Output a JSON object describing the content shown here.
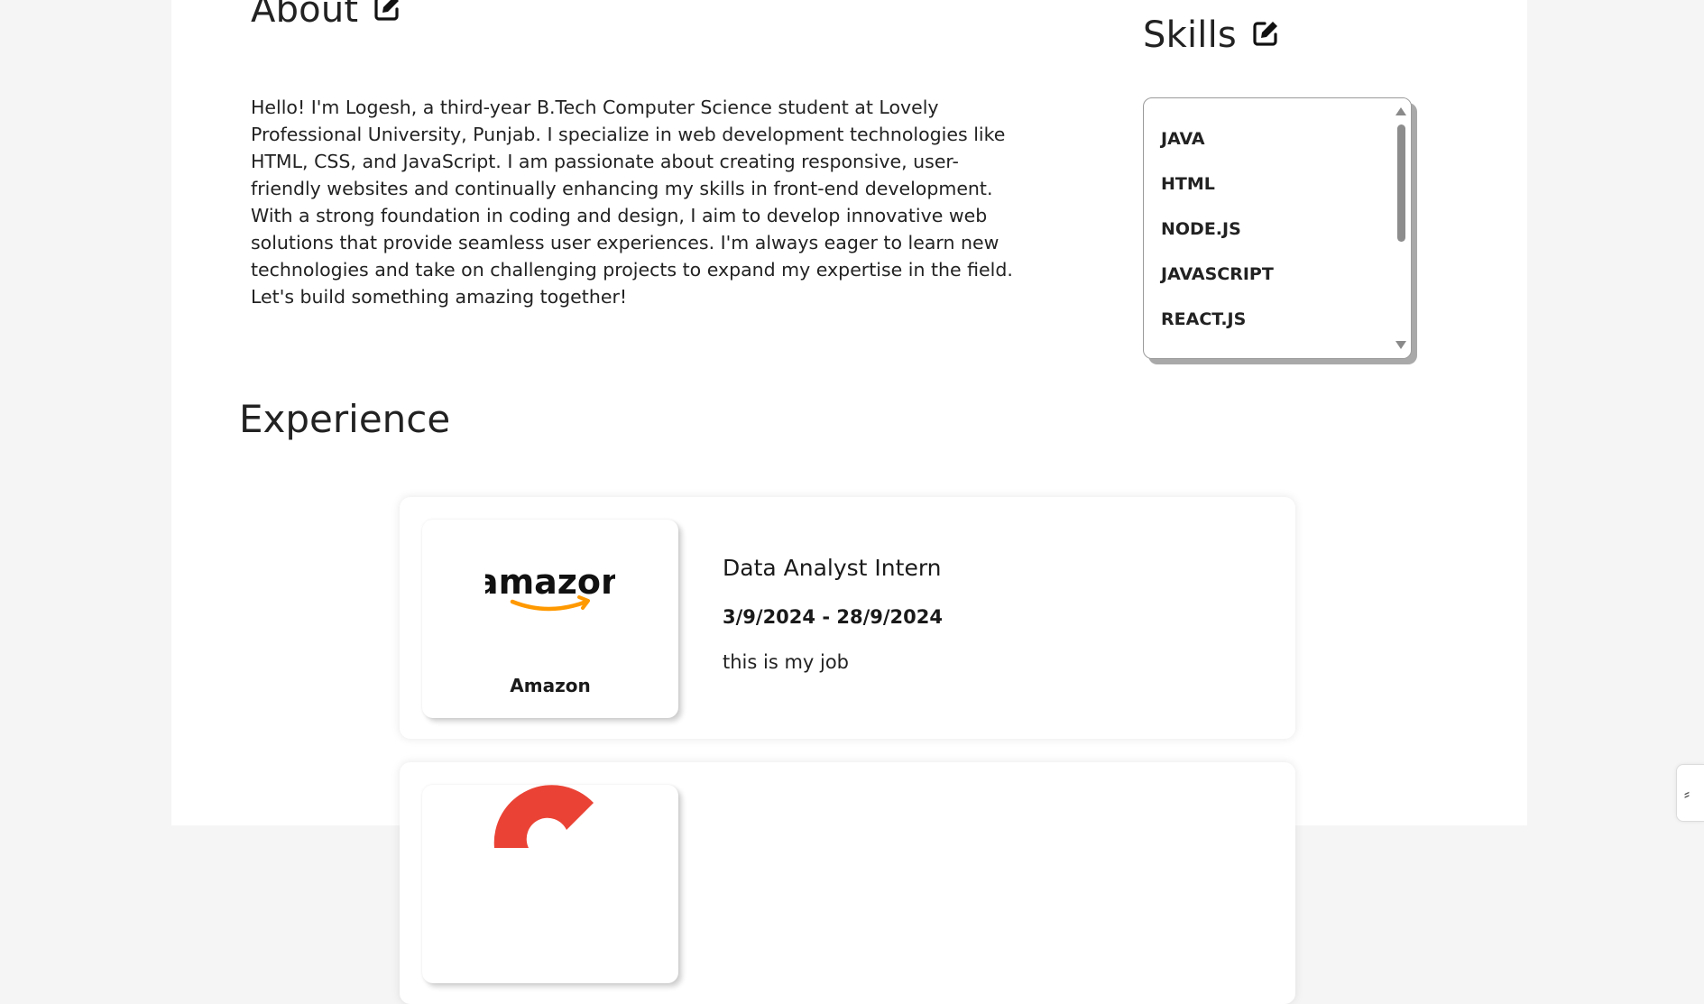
{
  "about": {
    "title": "About",
    "text": "Hello! I'm Logesh, a third-year B.Tech Computer Science student at Lovely Professional University, Punjab. I specialize in web development technologies like HTML, CSS, and JavaScript. I am passionate about creating responsive, user-friendly websites and continually enhancing my skills in front-end development. With a strong foundation in coding and design, I aim to develop innovative web solutions that provide seamless user experiences. I'm always eager to learn new technologies and take on challenging projects to expand my expertise in the field. Let's build something amazing together!",
    "edit_icon": "edit-icon"
  },
  "skills": {
    "title": "Skills",
    "edit_icon": "edit-icon",
    "items": [
      "JAVA",
      "HTML",
      "NODE.JS",
      "JAVASCRIPT",
      "REACT.JS"
    ]
  },
  "experience": {
    "title": "Experience",
    "items": [
      {
        "company": "Amazon",
        "logo_text": "amazon",
        "role": "Data Analyst Intern",
        "dates": "3/9/2024 - 28/9/2024",
        "description": "this is my job"
      }
    ]
  },
  "colors": {
    "page_background": "#f5f5f5",
    "panel_background": "#ffffff",
    "text": "#1f1f1f",
    "amazon_orange": "#ff9900",
    "google_red": "#ea4335"
  },
  "side_widget": {
    "icon": "resize-handle-icon",
    "glyph": "⸗"
  }
}
